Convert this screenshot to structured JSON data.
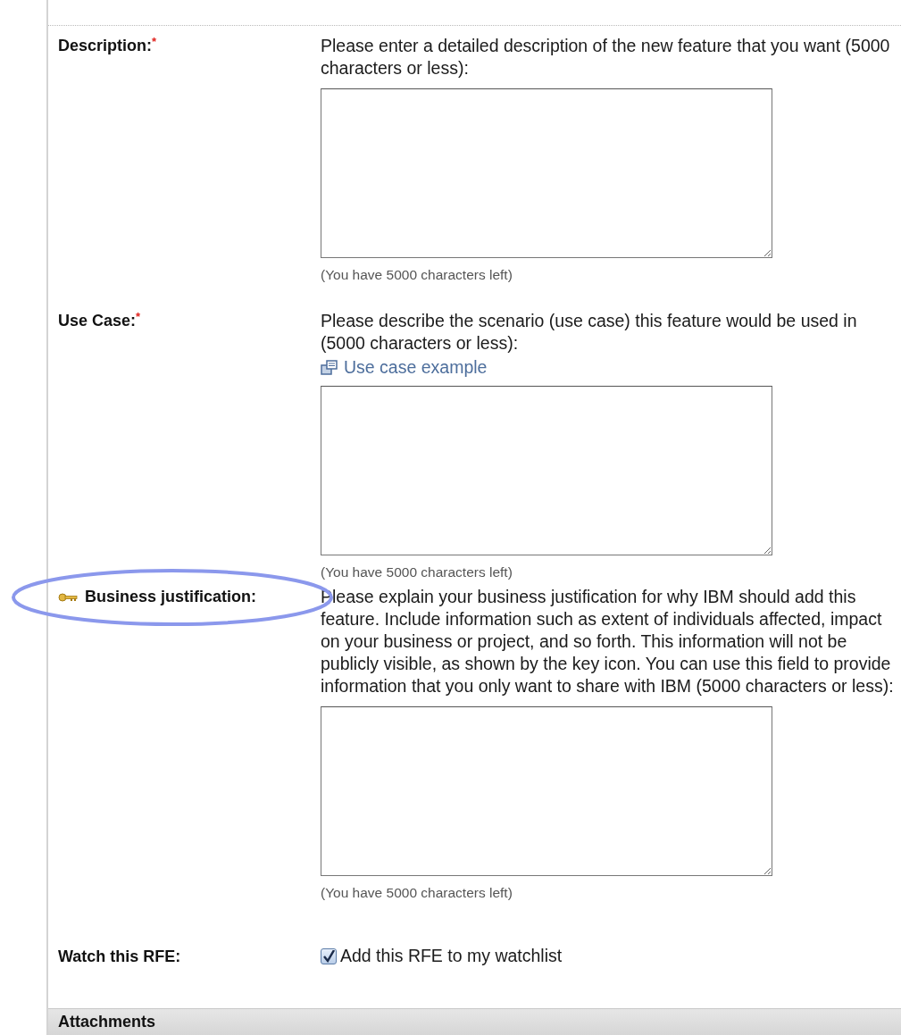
{
  "fields": [
    {
      "kind": "textarea",
      "label": "Description:",
      "required": true,
      "private": false,
      "highlighted": false,
      "description": "Please enter a detailed description of the new feature that you want (5000 characters or less):",
      "counter": "(You have 5000 characters left)"
    },
    {
      "kind": "textarea",
      "label": "Use Case:",
      "required": true,
      "private": false,
      "highlighted": false,
      "description": "Please describe the scenario (use case) this feature would be used in (5000 characters or less):",
      "link": "Use case example",
      "counter": "(You have 5000 characters left)"
    },
    {
      "kind": "textarea",
      "label": "Business justification:",
      "required": false,
      "private": true,
      "highlighted": true,
      "description": "Please explain your business justification for why IBM should add this feature. Include information such as extent of individuals affected, impact on your business or project, and so forth. This information will not be publicly visible, as shown by the key icon. You can use this field to provide information that you only want to share with IBM (5000 characters or less):",
      "counter": "(You have 5000 characters left)"
    },
    {
      "kind": "checkbox",
      "label": "Watch this RFE:",
      "required": false,
      "private": false,
      "highlighted": false,
      "option": "Add this RFE to my watchlist",
      "checked": true
    }
  ],
  "required_mark": "*",
  "section": {
    "title": "Attachments"
  }
}
